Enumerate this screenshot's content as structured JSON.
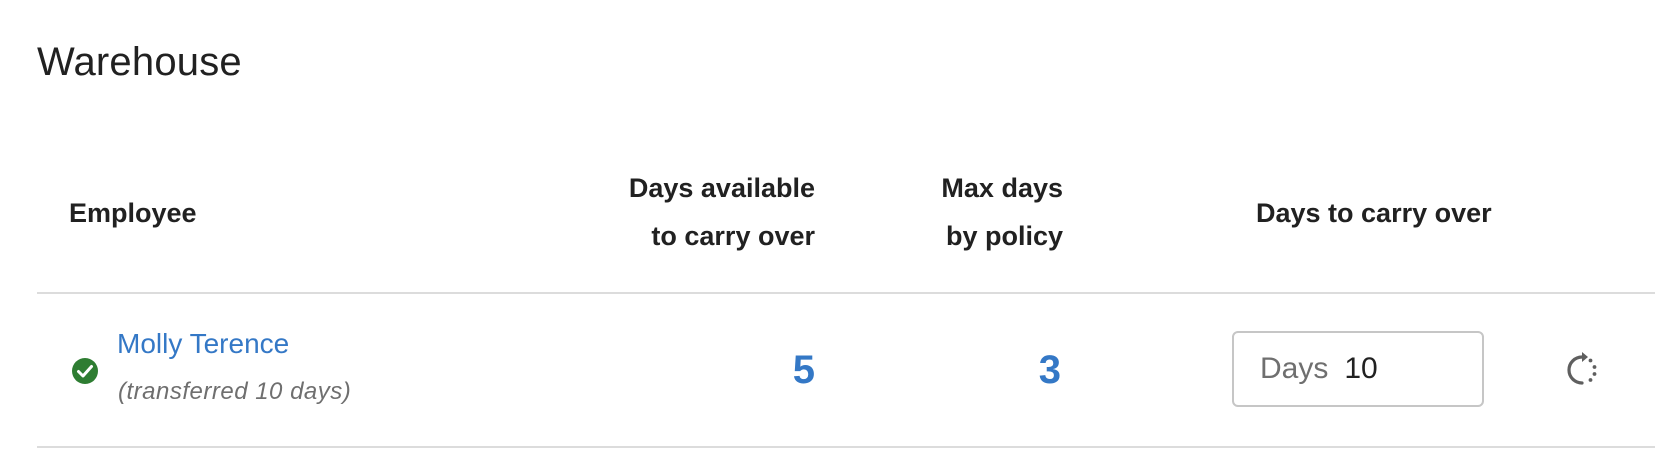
{
  "section": {
    "title": "Warehouse"
  },
  "table": {
    "headers": {
      "employee": "Employee",
      "days_available_line1": "Days available",
      "days_available_line2": "to carry over",
      "max_days_line1": "Max days",
      "max_days_line2": "by policy",
      "days_to_carry": "Days to carry over"
    },
    "rows": [
      {
        "status_icon": "check-circle-icon",
        "status_color": "#2e7d32",
        "name": "Molly Terence",
        "note": "(transferred 10 days)",
        "days_available": "5",
        "max_days": "3",
        "days_prefix": "Days",
        "days_to_carry": "10",
        "action_icon": "reset-icon"
      }
    ]
  },
  "colors": {
    "link": "#3478c6",
    "divider": "#dcdcdc",
    "success": "#2e7d32"
  }
}
